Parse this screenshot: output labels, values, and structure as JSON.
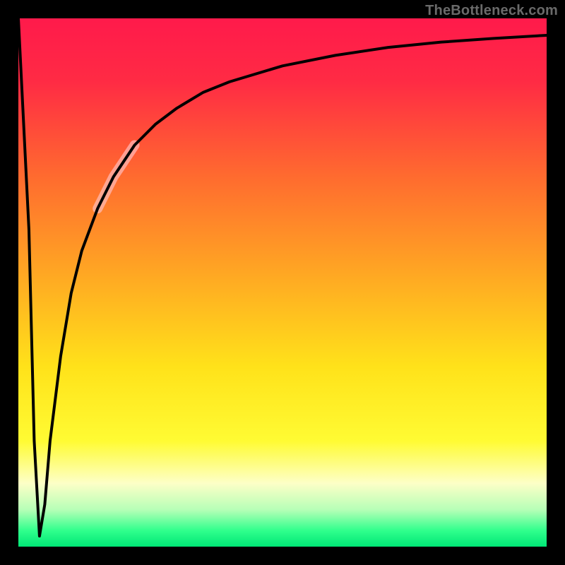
{
  "attribution": "TheBottleneck.com",
  "colors": {
    "frame": "#000000",
    "gradient_stops": [
      {
        "offset": 0.0,
        "color": "#ff1a4b"
      },
      {
        "offset": 0.12,
        "color": "#ff2b44"
      },
      {
        "offset": 0.3,
        "color": "#ff6b2f"
      },
      {
        "offset": 0.48,
        "color": "#ffa623"
      },
      {
        "offset": 0.66,
        "color": "#ffe21a"
      },
      {
        "offset": 0.8,
        "color": "#fffb33"
      },
      {
        "offset": 0.88,
        "color": "#fdffc7"
      },
      {
        "offset": 0.93,
        "color": "#b7ffb7"
      },
      {
        "offset": 0.97,
        "color": "#2fff8c"
      },
      {
        "offset": 1.0,
        "color": "#00e676"
      }
    ],
    "curve": "#000000",
    "highlight": "rgba(255,195,200,0.65)"
  },
  "chart_data": {
    "type": "line",
    "title": "",
    "xlabel": "",
    "ylabel": "",
    "xlim": [
      0,
      100
    ],
    "ylim": [
      0,
      100
    ],
    "grid": false,
    "legend": false,
    "series": [
      {
        "name": "bottleneck-curve",
        "x": [
          0,
          2,
          3,
          4,
          5,
          6,
          8,
          10,
          12,
          15,
          18,
          22,
          26,
          30,
          35,
          40,
          50,
          60,
          70,
          80,
          90,
          100
        ],
        "values": [
          100,
          60,
          20,
          2,
          8,
          20,
          36,
          48,
          56,
          64,
          70,
          76,
          80,
          83,
          86,
          88,
          91,
          93,
          94.5,
          95.5,
          96.2,
          96.8
        ]
      }
    ],
    "annotations": [
      {
        "name": "highlight-segment",
        "x_range": [
          15,
          22
        ],
        "note": "thick faded overlay on curve"
      }
    ]
  }
}
